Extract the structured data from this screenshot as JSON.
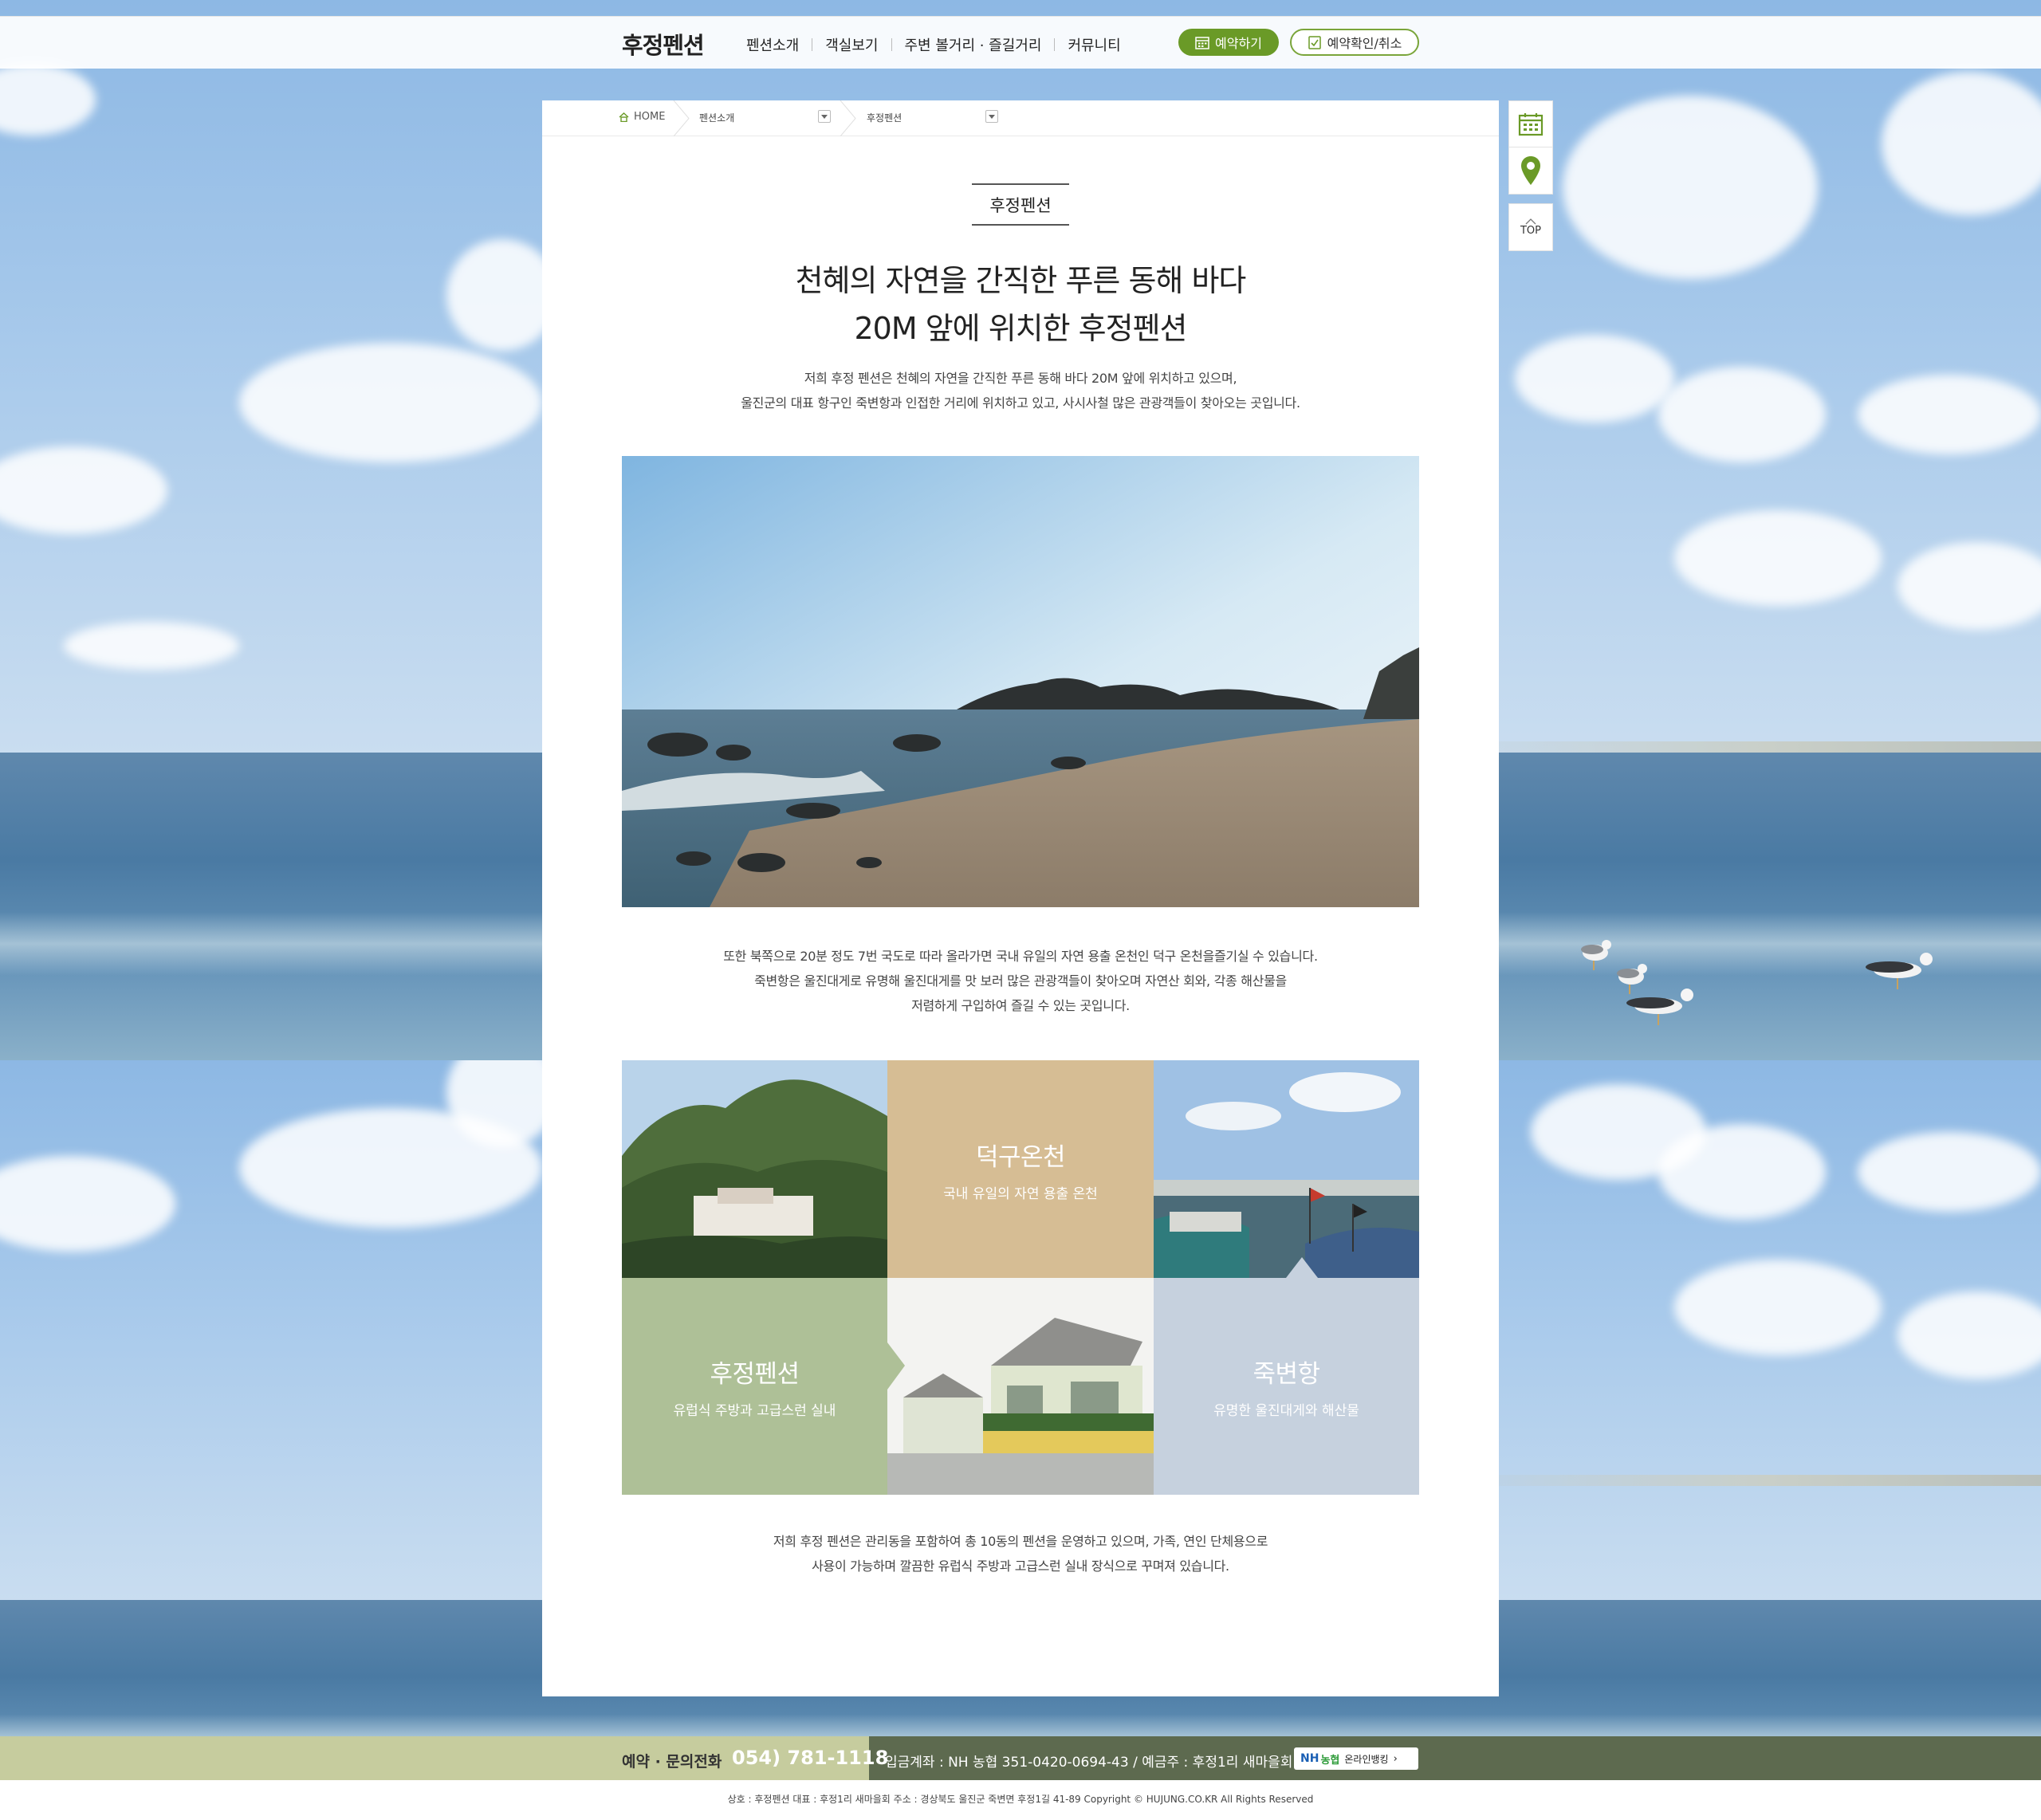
{
  "header": {
    "logo": "후정펜션",
    "nav": [
      "펜션소개",
      "객실보기",
      "주변 볼거리 · 즐길거리",
      "커뮤니티"
    ],
    "reserve_label": "예약하기",
    "check_label": "예약확인/취소"
  },
  "breadcrumb": {
    "home": "HOME",
    "level1": "펜션소개",
    "level2": "후정펜션"
  },
  "content": {
    "page_label": "후정펜션",
    "headline_line1": "천혜의 자연을 간직한 푸른 동해 바다",
    "headline_line2": "20M 앞에 위치한 후정펜션",
    "intro_line1": "저희 후정 펜션은 천혜의 자연을 간직한 푸른 동해 바다  20M 앞에 위치하고 있으며,",
    "intro_line2": "울진군의 대표 항구인 죽변항과 인접한 거리에 위치하고 있고, 사시사철 많은 관광객들이 찾아오는 곳입니다.",
    "para2_line1": "또한 북쪽으로 20분 정도 7번 국도로 따라 올라가면 국내 유일의 자연 용출 온천인 덕구 온천을즐기실 수 있습니다.",
    "para2_line2": "죽변항은 울진대게로 유명해 울진대게를 맛 보러 많은 관광객들이 찾아오며 자연산 회와, 각종 해산물을",
    "para2_line3": "저렴하게 구입하여 즐길 수 있는 곳입니다.",
    "para3_line1": "저희 후정 펜션은 관리동을 포함하여 총 10동의 펜션을 운영하고 있으며, 가족, 연인 단체용으로",
    "para3_line2": "사용이 가능하며 깔끔한 유럽식 주방과 고급스런 실내 장식으로 꾸며져 있습니다."
  },
  "tiles": [
    {
      "title": "덕구온천",
      "subtitle": "국내 유일의 자연 용출 온천",
      "color": "#d6bd94"
    },
    {
      "title": "후정펜션",
      "subtitle": "유럽식 주방과 고급스런 실내",
      "color": "#aec097"
    },
    {
      "title": "죽변항",
      "subtitle": "유명한 울진대게와 해산물",
      "color": "#c6d1de"
    }
  ],
  "quick_menu": {
    "top_label": "TOP"
  },
  "footer": {
    "tel_label": "예약 · 문의전화",
    "tel_number": "054) 781-1118",
    "account": "입금계좌 : NH 농협 351-0420-0694-43 / 예금주 : 후정1리 새마을회",
    "bank_nh": "NH",
    "bank_nhk": "농협",
    "bank_label": "온라인뱅킹",
    "info": "상호 : 후정펜션   대표 : 후정1리 새마을회   주소 : 경상북도 울진군 죽변면 후정1길 41-89   Copyright © HUJUNG.CO.KR All Rights Reserved"
  },
  "colors": {
    "accent_green": "#6a9a27",
    "footer_left": "#c6cc9e",
    "footer_right": "#5d6a4f"
  }
}
